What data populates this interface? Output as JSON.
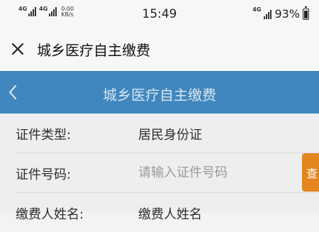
{
  "status_bar": {
    "network_1": "4G",
    "network_2": "4G",
    "speed_value": "0.00",
    "speed_unit": "KB/s",
    "time": "15:49",
    "right_network": "4G",
    "battery_percent": "93%",
    "battery_level": 0.93
  },
  "app_header": {
    "title": "城乡医疗自主缴费",
    "close_icon": "close-icon"
  },
  "nav_bar": {
    "title": "城乡医疗自主缴费",
    "back_icon": "chevron-left-icon",
    "color": "#3f87be"
  },
  "form": {
    "id_type": {
      "label": "证件类型:",
      "value": "居民身份证"
    },
    "id_number": {
      "label": "证件号码:",
      "placeholder": "请输入证件号码",
      "value": ""
    },
    "query_button": {
      "label": "查",
      "color": "#e2861d"
    },
    "payer_name": {
      "label": "缴费人姓名:",
      "value": "缴费人姓名"
    }
  }
}
